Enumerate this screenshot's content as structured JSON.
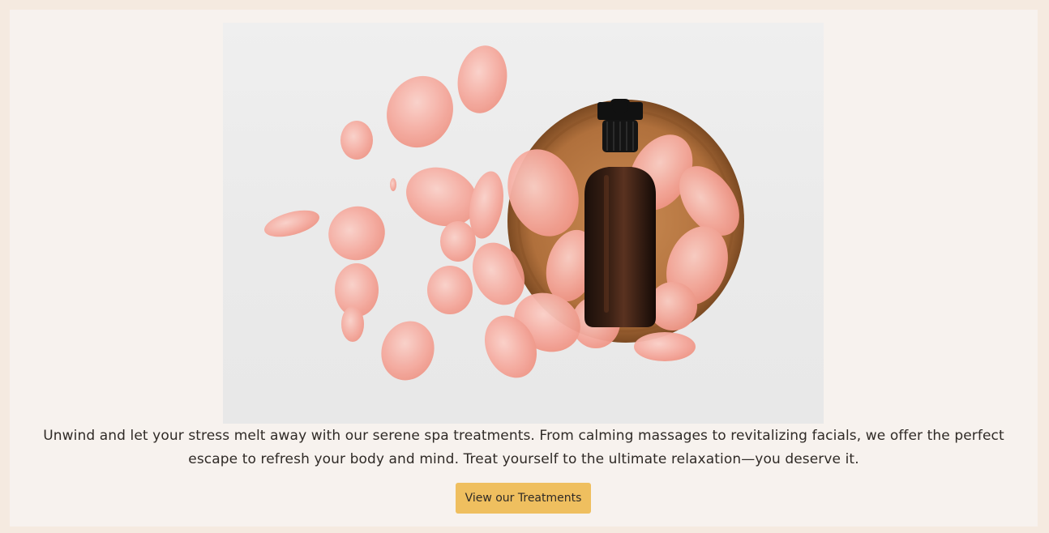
{
  "hero": {
    "image_alt": "Dark glass dropper bottle on a wooden dish surrounded by pink rose petals"
  },
  "description": "Unwind and let your stress melt away with our serene spa treatments. From calming massages to revitalizing facials, we offer the perfect escape to refresh your body and mind. Treat yourself to the ultimate relaxation—you deserve it.",
  "cta": {
    "label": "View our Treatments"
  },
  "colors": {
    "page_background": "#f5eae0",
    "card_background": "#f7f2ee",
    "button": "#efbf5f",
    "text": "#2f2a26"
  }
}
